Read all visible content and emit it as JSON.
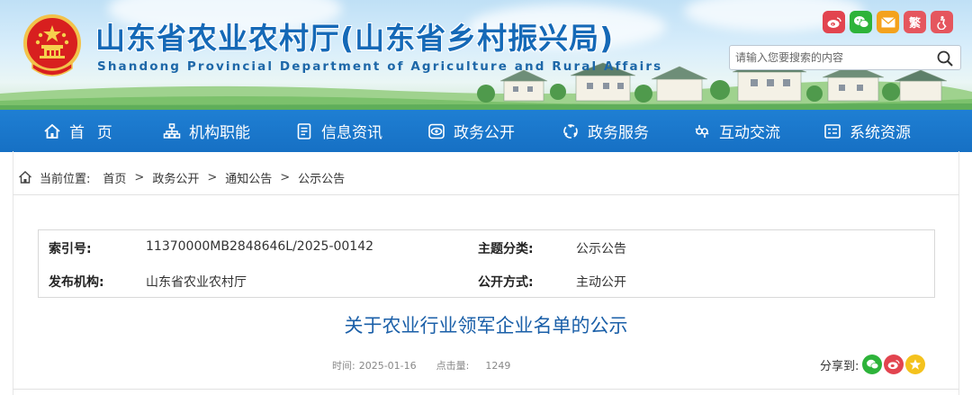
{
  "header": {
    "title_cn": "山东省农业农村厅(山东省乡村振兴局)",
    "title_en": "Shandong Provincial Department of Agriculture and Rural Affairs",
    "social": [
      {
        "icon": "weibo-icon",
        "glyph": ""
      },
      {
        "icon": "wechat-icon",
        "glyph": ""
      },
      {
        "icon": "mail-icon",
        "glyph": ""
      },
      {
        "icon": "traditional-chinese-icon",
        "glyph": "繁"
      },
      {
        "icon": "accessibility-icon",
        "glyph": ""
      }
    ],
    "search": {
      "placeholder": "请输入您要搜索的内容"
    }
  },
  "nav": {
    "items": [
      {
        "label": "首  页",
        "icon": "home-icon"
      },
      {
        "label": "机构职能",
        "icon": "org-icon"
      },
      {
        "label": "信息资讯",
        "icon": "document-icon"
      },
      {
        "label": "政务公开",
        "icon": "eye-icon"
      },
      {
        "label": "政务服务",
        "icon": "service-icon"
      },
      {
        "label": "互动交流",
        "icon": "chat-icon"
      },
      {
        "label": "系统资源",
        "icon": "system-icon"
      }
    ]
  },
  "breadcrumb": {
    "prefix": "当前位置:",
    "items": [
      "首页",
      "政务公开",
      "通知公告",
      "公示公告"
    ],
    "separator": ">"
  },
  "meta": {
    "index_label": "索引号:",
    "index_value": "11370000MB2848646L/2025-00142",
    "topic_label": "主题分类:",
    "topic_value": "公示公告",
    "publisher_label": "发布机构:",
    "publisher_value": "山东省农业农村厅",
    "mode_label": "公开方式:",
    "mode_value": "主动公开"
  },
  "article": {
    "title": "关于农业行业领军企业名单的公示",
    "time_label": "时间:",
    "time_value": "2025-01-16",
    "clicks_label": "点击量:",
    "clicks_value": "1249",
    "share_label": "分享到:"
  },
  "colors": {
    "brand_blue": "#1670c4",
    "title_blue": "#1a5fa8",
    "weibo_red": "#e2444f",
    "wechat_green": "#2db33a",
    "qzone_yellow": "#f4c21d"
  }
}
